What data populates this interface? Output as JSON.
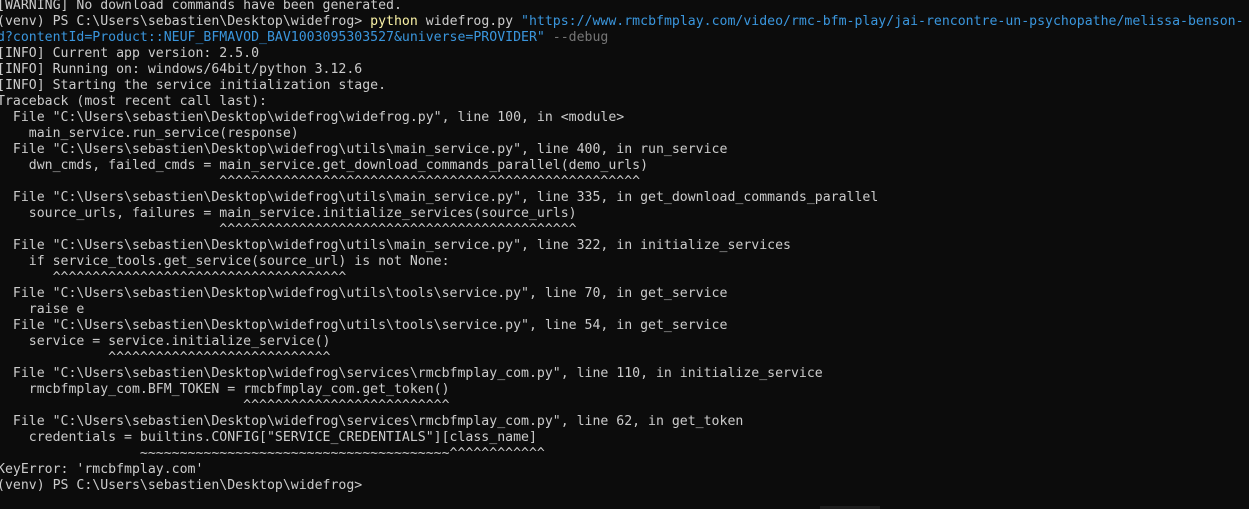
{
  "terminal": {
    "lines": [
      "[WARNING] No download commands have been generated.",
      {
        "prompt": "(venv) PS C:\\Users\\sebastien\\Desktop\\widefrog> ",
        "cmd": "python",
        "arg": " widefrog.py ",
        "str": "\"https://www.rmcbfmplay.com/video/rmc-bfm-play/jai-rencontre-un-psychopathe/melissa-benson-"
      },
      {
        "str": "d?contentId=Product::NEUF_BFMAVOD_BAV1003095303527&universe=PROVIDER\"",
        "param": " --debug"
      },
      "[INFO] Current app version: 2.5.0",
      "[INFO] Running on: windows/64bit/python 3.12.6",
      "[INFO] Starting the service initialization stage.",
      "Traceback (most recent call last):",
      "  File \"C:\\Users\\sebastien\\Desktop\\widefrog\\widefrog.py\", line 100, in <module>",
      "    main_service.run_service(response)",
      "  File \"C:\\Users\\sebastien\\Desktop\\widefrog\\utils\\main_service.py\", line 400, in run_service",
      "    dwn_cmds, failed_cmds = main_service.get_download_commands_parallel(demo_urls)",
      "                            ^^^^^^^^^^^^^^^^^^^^^^^^^^^^^^^^^^^^^^^^^^^^^^^^^^^^^",
      "  File \"C:\\Users\\sebastien\\Desktop\\widefrog\\utils\\main_service.py\", line 335, in get_download_commands_parallel",
      "    source_urls, failures = main_service.initialize_services(source_urls)",
      "                            ^^^^^^^^^^^^^^^^^^^^^^^^^^^^^^^^^^^^^^^^^^^^^",
      "  File \"C:\\Users\\sebastien\\Desktop\\widefrog\\utils\\main_service.py\", line 322, in initialize_services",
      "    if service_tools.get_service(source_url) is not None:",
      "       ^^^^^^^^^^^^^^^^^^^^^^^^^^^^^^^^^^^^^",
      "  File \"C:\\Users\\sebastien\\Desktop\\widefrog\\utils\\tools\\service.py\", line 70, in get_service",
      "    raise e",
      "  File \"C:\\Users\\sebastien\\Desktop\\widefrog\\utils\\tools\\service.py\", line 54, in get_service",
      "    service = service.initialize_service()",
      "              ^^^^^^^^^^^^^^^^^^^^^^^^^^^^",
      "  File \"C:\\Users\\sebastien\\Desktop\\widefrog\\services\\rmcbfmplay_com.py\", line 110, in initialize_service",
      "    rmcbfmplay_com.BFM_TOKEN = rmcbfmplay_com.get_token()",
      "                               ^^^^^^^^^^^^^^^^^^^^^^^^^^",
      "  File \"C:\\Users\\sebastien\\Desktop\\widefrog\\services\\rmcbfmplay_com.py\", line 62, in get_token",
      "    credentials = builtins.CONFIG[\"SERVICE_CREDENTIALS\"][class_name]",
      "                  ~~~~~~~~~~~~~~~~~~~~~~~~~~~~~~~~~~~~~~~^^^^^^^^^^^^",
      "KeyError: 'rmcbfmplay.com'",
      "(venv) PS C:\\Users\\sebastien\\Desktop\\widefrog> "
    ],
    "colors": {
      "background": "#0c0c0c",
      "text": "#cccccc",
      "command": "#f9f1a5",
      "string": "#3a96dd",
      "parameter": "#767676"
    }
  }
}
